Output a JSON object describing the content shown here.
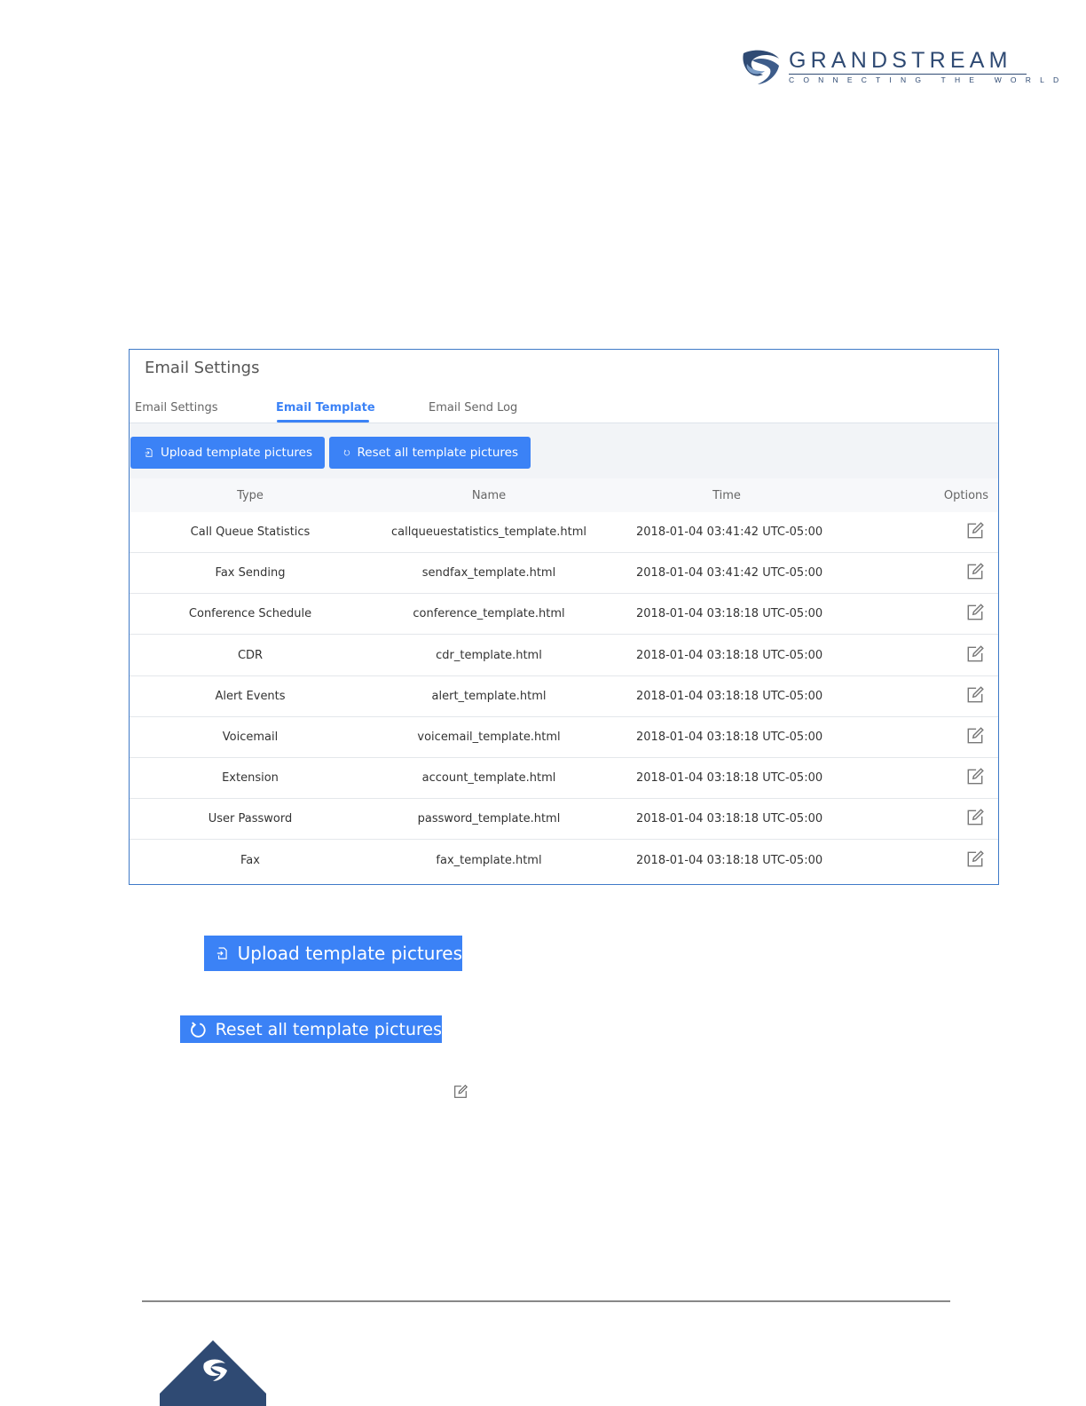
{
  "brand": {
    "name": "GRANDSTREAM",
    "tagline": "CONNECTING THE WORLD",
    "colors": {
      "navy": "#2f4a73",
      "accent": "#3b82f6",
      "panel_border": "#3f7ac8"
    }
  },
  "panel": {
    "title": "Email Settings",
    "tabs": [
      {
        "label": "Email Settings",
        "active": false
      },
      {
        "label": "Email Template",
        "active": true
      },
      {
        "label": "Email Send Log",
        "active": false
      }
    ],
    "toolbar": {
      "upload_label": "Upload template pictures",
      "upload_icon": "upload-file-icon",
      "reset_label": "Reset all template pictures",
      "reset_icon": "refresh-icon"
    },
    "table": {
      "columns": [
        "Type",
        "Name",
        "Time",
        "Options"
      ],
      "rows": [
        {
          "type": "Call Queue Statistics",
          "name": "callqueuestatistics_template.html",
          "time": "2018-01-04 03:41:42 UTC-05:00",
          "option_icon": "edit-icon"
        },
        {
          "type": "Fax Sending",
          "name": "sendfax_template.html",
          "time": "2018-01-04 03:41:42 UTC-05:00",
          "option_icon": "edit-icon"
        },
        {
          "type": "Conference Schedule",
          "name": "conference_template.html",
          "time": "2018-01-04 03:18:18 UTC-05:00",
          "option_icon": "edit-icon"
        },
        {
          "type": "CDR",
          "name": "cdr_template.html",
          "time": "2018-01-04 03:18:18 UTC-05:00",
          "option_icon": "edit-icon"
        },
        {
          "type": "Alert Events",
          "name": "alert_template.html",
          "time": "2018-01-04 03:18:18 UTC-05:00",
          "option_icon": "edit-icon"
        },
        {
          "type": "Voicemail",
          "name": "voicemail_template.html",
          "time": "2018-01-04 03:18:18 UTC-05:00",
          "option_icon": "edit-icon"
        },
        {
          "type": "Extension",
          "name": "account_template.html",
          "time": "2018-01-04 03:18:18 UTC-05:00",
          "option_icon": "edit-icon"
        },
        {
          "type": "User Password",
          "name": "password_template.html",
          "time": "2018-01-04 03:18:18 UTC-05:00",
          "option_icon": "edit-icon"
        },
        {
          "type": "Fax",
          "name": "fax_template.html",
          "time": "2018-01-04 03:18:18 UTC-05:00",
          "option_icon": "edit-icon"
        }
      ]
    }
  },
  "standalone": {
    "upload_label": "Upload template pictures",
    "reset_label": "Reset all template pictures",
    "edit_icon": "edit-icon"
  }
}
